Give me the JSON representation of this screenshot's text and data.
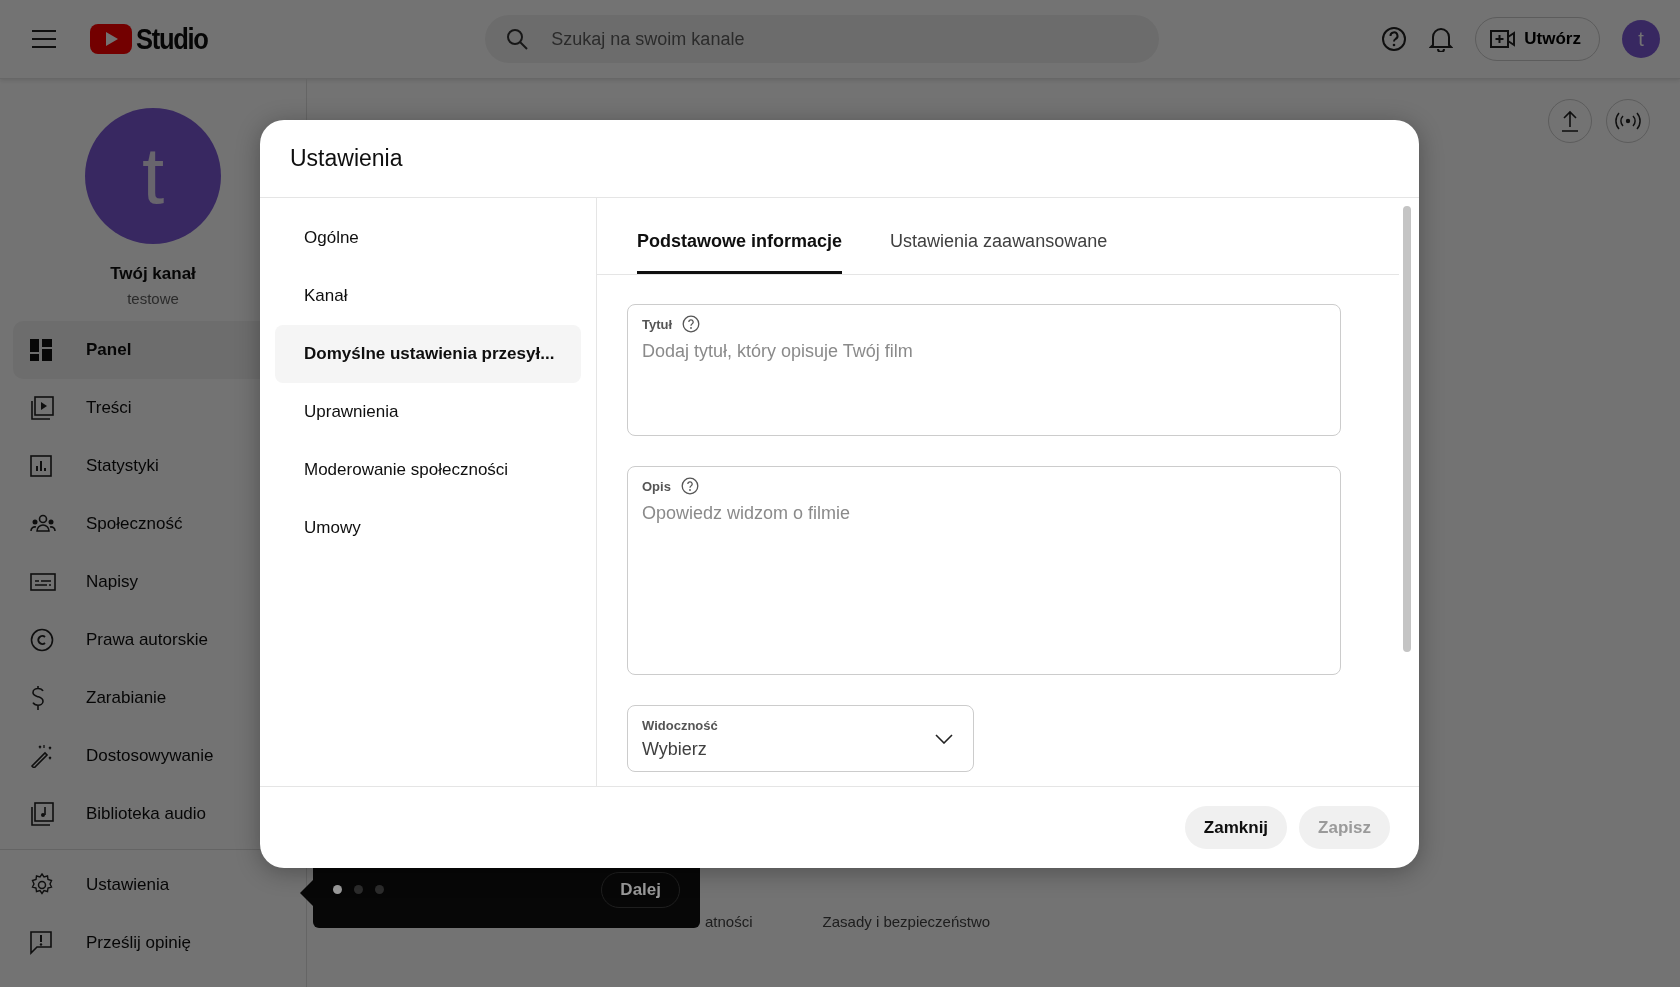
{
  "topbar": {
    "logo_text": "Studio",
    "search": {
      "placeholder": "Szukaj na swoim kanale"
    },
    "create_button": "Utwórz",
    "avatar_letter": "t"
  },
  "sidebar": {
    "avatar_letter": "t",
    "channel_name": "Twój kanał",
    "channel_handle": "testowe",
    "items": [
      {
        "label": "Panel",
        "kind": "dashboard",
        "selected": true
      },
      {
        "label": "Treści",
        "kind": "content",
        "selected": false
      },
      {
        "label": "Statystyki",
        "kind": "analytics",
        "selected": false
      },
      {
        "label": "Społeczność",
        "kind": "community",
        "selected": false
      },
      {
        "label": "Napisy",
        "kind": "subtitles",
        "selected": false
      },
      {
        "label": "Prawa autorskie",
        "kind": "copyright",
        "selected": false
      },
      {
        "label": "Zarabianie",
        "kind": "money",
        "selected": false
      },
      {
        "label": "Dostosowywanie",
        "kind": "wand",
        "selected": false
      },
      {
        "label": "Biblioteka audio",
        "kind": "audio",
        "selected": false
      }
    ],
    "bottom_items": [
      {
        "label": "Ustawienia",
        "kind": "gear"
      },
      {
        "label": "Prześlij opinię",
        "kind": "feedback"
      }
    ]
  },
  "footer_links": [
    "atności",
    "Zasady i bezpieczeństwo"
  ],
  "tour_tip": {
    "steps": [
      {
        "selected": true
      },
      {
        "selected": false
      },
      {
        "selected": false
      }
    ],
    "next_button": "Dalej"
  },
  "dialog": {
    "title": "Ustawienia",
    "nav": [
      {
        "label": "Ogólne",
        "selected": false
      },
      {
        "label": "Kanał",
        "selected": false
      },
      {
        "label": "Domyślne ustawienia przesył...",
        "selected": true
      },
      {
        "label": "Uprawnienia",
        "selected": false
      },
      {
        "label": "Moderowanie społeczności",
        "selected": false
      },
      {
        "label": "Umowy",
        "selected": false
      }
    ],
    "tabs": [
      {
        "label": "Podstawowe informacje",
        "selected": true
      },
      {
        "label": "Ustawienia zaawansowane",
        "selected": false
      }
    ],
    "fields": [
      {
        "kind": "short",
        "label": "Tytuł",
        "help": true,
        "placeholder": "Dodaj tytuł, który opisuje Twój film"
      },
      {
        "kind": "long",
        "label": "Opis",
        "help": true,
        "placeholder": "Opowiedz widzom o filmie"
      },
      {
        "kind": "select",
        "label": "Widoczność",
        "value": "Wybierz"
      }
    ],
    "buttons": [
      {
        "label": "Zamknij",
        "disabled": false
      },
      {
        "label": "Zapisz",
        "disabled": true
      }
    ]
  }
}
